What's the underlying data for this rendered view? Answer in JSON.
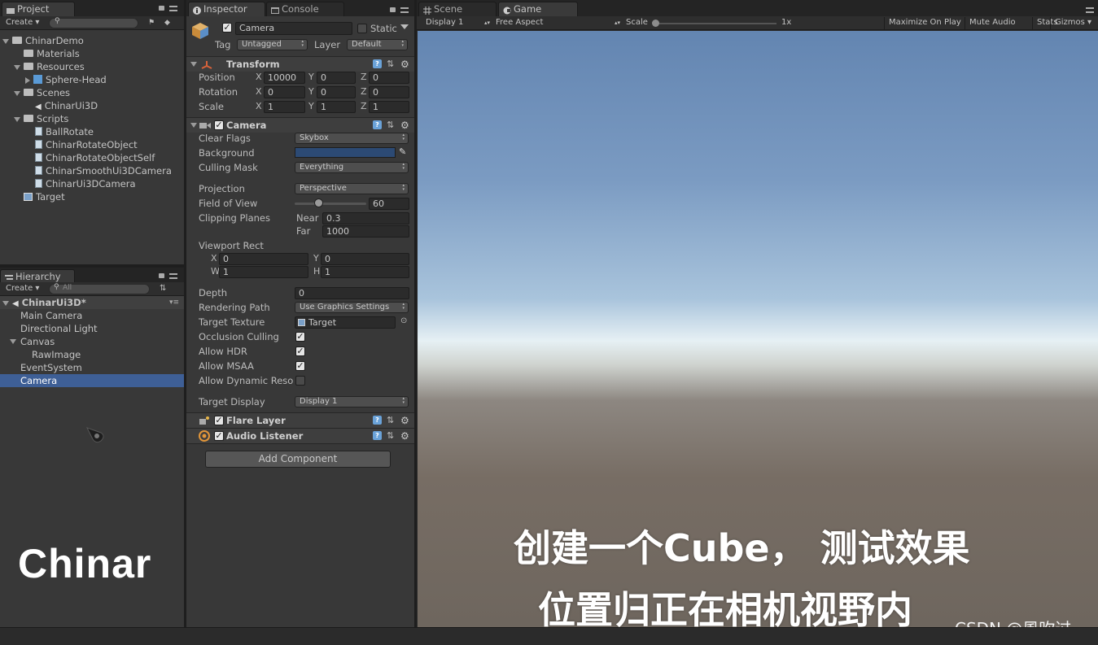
{
  "project": {
    "tab_label": "Project",
    "create_label": "Create",
    "tree": [
      {
        "label": "ChinarDemo",
        "type": "folder",
        "indent": 0,
        "expanded": true
      },
      {
        "label": "Materials",
        "type": "folder",
        "indent": 1,
        "expanded": null
      },
      {
        "label": "Resources",
        "type": "folder",
        "indent": 1,
        "expanded": true
      },
      {
        "label": "Sphere-Head",
        "type": "prefab",
        "indent": 2,
        "expanded": false
      },
      {
        "label": "Scenes",
        "type": "folder",
        "indent": 1,
        "expanded": true
      },
      {
        "label": "ChinarUi3D",
        "type": "scene",
        "indent": 2,
        "expanded": null
      },
      {
        "label": "Scripts",
        "type": "folder",
        "indent": 1,
        "expanded": true
      },
      {
        "label": "BallRotate",
        "type": "script",
        "indent": 2,
        "expanded": null
      },
      {
        "label": "ChinarRotateObject",
        "type": "script",
        "indent": 2,
        "expanded": null
      },
      {
        "label": "ChinarRotateObjectSelf",
        "type": "script",
        "indent": 2,
        "expanded": null
      },
      {
        "label": "ChinarSmoothUi3DCamera",
        "type": "script",
        "indent": 2,
        "expanded": null
      },
      {
        "label": "ChinarUi3DCamera",
        "type": "script",
        "indent": 2,
        "expanded": null
      },
      {
        "label": "Target",
        "type": "rendertexture",
        "indent": 1,
        "expanded": null
      }
    ]
  },
  "hierarchy": {
    "tab_label": "Hierarchy",
    "create_label": "Create",
    "search_placeholder": "All",
    "scene_name": "ChinarUi3D*",
    "items": [
      {
        "label": "Main Camera",
        "indent": 1,
        "selected": false
      },
      {
        "label": "Directional Light",
        "indent": 1,
        "selected": false
      },
      {
        "label": "Canvas",
        "indent": 1,
        "selected": false
      },
      {
        "label": "RawImage",
        "indent": 2,
        "selected": false
      },
      {
        "label": "EventSystem",
        "indent": 1,
        "selected": false
      },
      {
        "label": "Camera",
        "indent": 1,
        "selected": true
      }
    ],
    "watermark": "Chinar"
  },
  "inspector": {
    "tab_label": "Inspector",
    "console_tab_label": "Console",
    "object_name": "Camera",
    "static_label": "Static",
    "tag_label": "Tag",
    "tag_value": "Untagged",
    "layer_label": "Layer",
    "layer_value": "Default",
    "transform": {
      "title": "Transform",
      "rows": [
        {
          "label": "Position",
          "x": "10000",
          "y": "0",
          "z": "0"
        },
        {
          "label": "Rotation",
          "x": "0",
          "y": "0",
          "z": "0"
        },
        {
          "label": "Scale",
          "x": "1",
          "y": "1",
          "z": "1"
        }
      ]
    },
    "camera": {
      "title": "Camera",
      "clear_flags_label": "Clear Flags",
      "clear_flags_value": "Skybox",
      "background_label": "Background",
      "background_color": "#2c4a74",
      "culling_mask_label": "Culling Mask",
      "culling_mask_value": "Everything",
      "projection_label": "Projection",
      "projection_value": "Perspective",
      "fov_label": "Field of View",
      "fov_value": "60",
      "fov_fraction": 0.33,
      "clipping_label": "Clipping Planes",
      "near_label": "Near",
      "near_value": "0.3",
      "far_label": "Far",
      "far_value": "1000",
      "viewport_label": "Viewport Rect",
      "vp_x": "0",
      "vp_y": "0",
      "vp_w": "1",
      "vp_h": "1",
      "depth_label": "Depth",
      "depth_value": "0",
      "rendering_path_label": "Rendering Path",
      "rendering_path_value": "Use Graphics Settings",
      "target_texture_label": "Target Texture",
      "target_texture_value": "Target",
      "occlusion_label": "Occlusion Culling",
      "hdr_label": "Allow HDR",
      "msaa_label": "Allow MSAA",
      "dynres_label": "Allow Dynamic Reso",
      "occlusion_checked": true,
      "hdr_checked": true,
      "msaa_checked": true,
      "dynres_checked": false,
      "target_display_label": "Target Display",
      "target_display_value": "Display 1"
    },
    "flare_layer_title": "Flare Layer",
    "audio_listener_title": "Audio Listener",
    "add_component_label": "Add Component"
  },
  "game": {
    "scene_tab_label": "Scene",
    "game_tab_label": "Game",
    "display_value": "Display 1",
    "aspect_value": "Free Aspect",
    "scale_label": "Scale",
    "scale_value": "1x",
    "maximize_label": "Maximize On Play",
    "mute_label": "Mute Audio",
    "stats_label": "Stats",
    "gizmos_label": "Gizmos",
    "caption_line1": "创建一个Cube， 测试效果",
    "caption_line2": "位置归正在相机视野内",
    "credit": "CSDN @風吹过"
  }
}
